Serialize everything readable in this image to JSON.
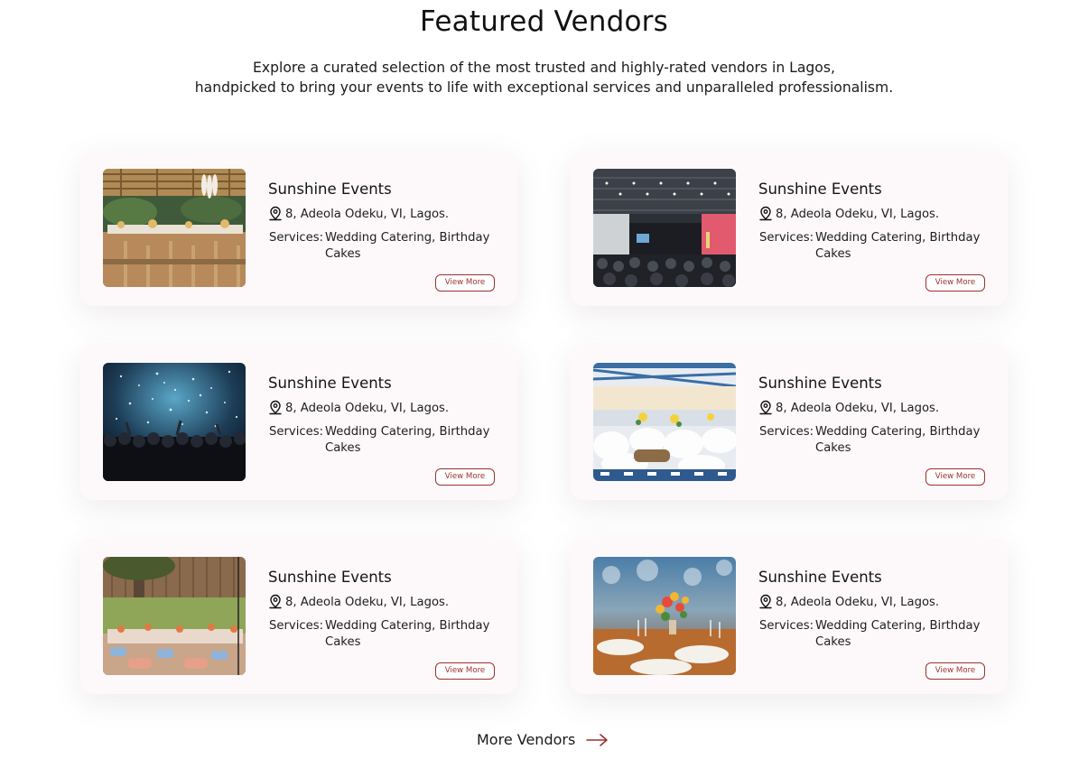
{
  "section": {
    "title": "Featured Vendors",
    "subtitle_line1": "Explore a curated selection of the most trusted and highly-rated vendors in Lagos,",
    "subtitle_line2": "handpicked to bring your events to life with exceptional services and unparalleled professionalism."
  },
  "vendors": [
    {
      "name": "Sunshine Events",
      "address": "8, Adeola Odeku, VI, Lagos.",
      "services_label": "Services:",
      "services": "Wedding Catering, Birthday Cakes",
      "button": "View More",
      "photo": "outdoor-banquet-photo"
    },
    {
      "name": "Sunshine Events",
      "address": "8, Adeola Odeku, VI, Lagos.",
      "services_label": "Services:",
      "services": "Wedding Catering, Birthday Cakes",
      "button": "View More",
      "photo": "conference-hall-photo"
    },
    {
      "name": "Sunshine Events",
      "address": "8, Adeola Odeku, VI, Lagos.",
      "services_label": "Services:",
      "services": "Wedding Catering, Birthday Cakes",
      "button": "View More",
      "photo": "concert-confetti-photo"
    },
    {
      "name": "Sunshine Events",
      "address": "8, Adeola Odeku, VI, Lagos.",
      "services_label": "Services:",
      "services": "Wedding Catering, Birthday Cakes",
      "button": "View More",
      "photo": "tent-reception-photo"
    },
    {
      "name": "Sunshine Events",
      "address": "8, Adeola Odeku, VI, Lagos.",
      "services_label": "Services:",
      "services": "Wedding Catering, Birthday Cakes",
      "button": "View More",
      "photo": "garden-picnic-photo"
    },
    {
      "name": "Sunshine Events",
      "address": "8, Adeola Odeku, VI, Lagos.",
      "services_label": "Services:",
      "services": "Wedding Catering, Birthday Cakes",
      "button": "View More",
      "photo": "table-setting-photo"
    }
  ],
  "more_link": {
    "label": "More Vendors",
    "icon": "arrow-right-icon"
  },
  "colors": {
    "accent": "#9e2f2f",
    "card_bg": "#fdf9fa",
    "text": "#111111"
  }
}
